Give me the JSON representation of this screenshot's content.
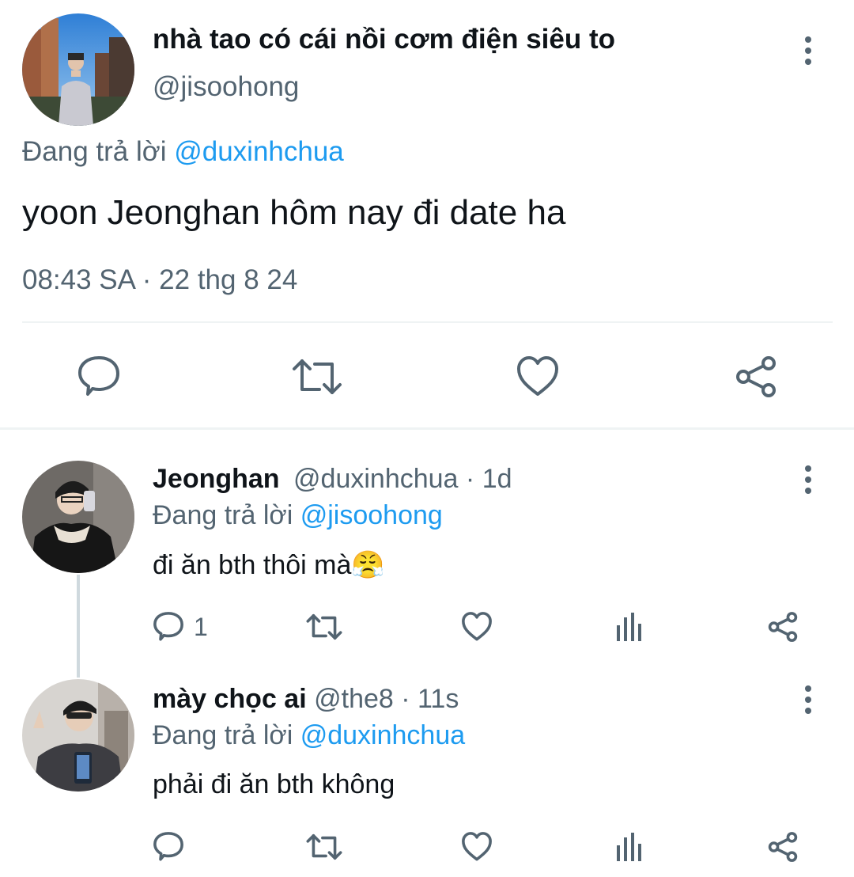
{
  "main_tweet": {
    "display_name": "nhà tao có cái nồi cơm điện siêu to",
    "handle": "@jisoohong",
    "reply_prefix": "Đang trả lời",
    "reply_to": "@duxinhchua",
    "text": "yoon Jeonghan hôm nay đi date ha",
    "timestamp": "08:43 SA · 22 thg 8 24",
    "actions": [
      "reply-icon",
      "retweet-icon",
      "like-icon",
      "share-icon"
    ]
  },
  "replies": [
    {
      "display_name": "Jeonghan",
      "handle": "@duxinhchua",
      "time": "· 1d",
      "reply_prefix": "Đang trả lời",
      "reply_to": "@jisoohong",
      "text": "đi ăn bth thôi mà",
      "emoji": "😤",
      "reply_count": "1",
      "actions": [
        "reply-icon",
        "retweet-icon",
        "like-icon",
        "analytics-icon",
        "share-icon"
      ]
    },
    {
      "display_name": "mày chọc ai",
      "handle": "@the8",
      "time": "· 11s",
      "reply_prefix": "Đang trả lời",
      "reply_to": "@duxinhchua",
      "text": "phải đi ăn bth không",
      "reply_count": "",
      "actions": [
        "reply-icon",
        "retweet-icon",
        "like-icon",
        "analytics-icon",
        "share-icon"
      ]
    }
  ],
  "colors": {
    "text": "#0f1419",
    "secondary": "#536471",
    "link": "#1d9bf0",
    "divider": "#eff3f4"
  }
}
